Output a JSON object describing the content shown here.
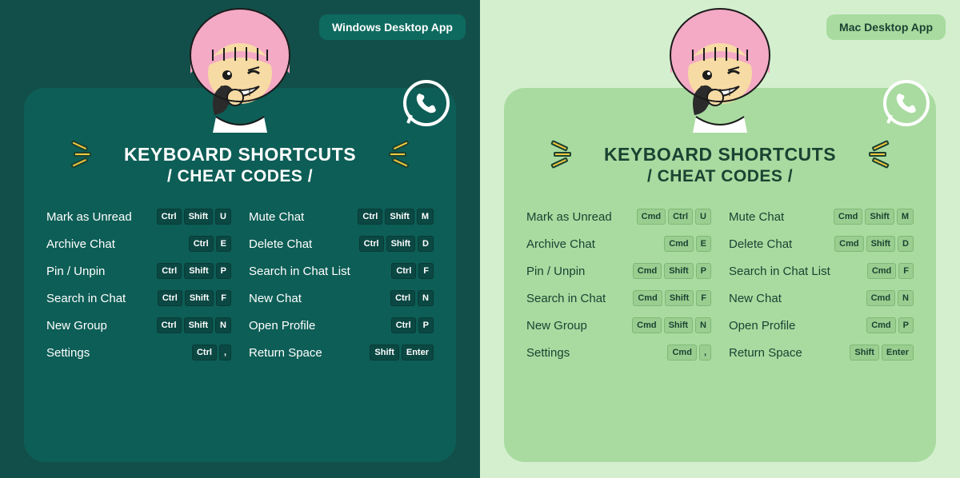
{
  "title_line1": "KEYBOARD SHORTCUTS",
  "title_line2": "/ CHEAT CODES /",
  "panels": [
    {
      "badge": "Windows Desktop App",
      "theme": "dark",
      "colA": [
        {
          "label": "Mark as Unread",
          "keys": [
            "Ctrl",
            "Shift",
            "U"
          ]
        },
        {
          "label": "Archive Chat",
          "keys": [
            "Ctrl",
            "E"
          ]
        },
        {
          "label": "Pin / Unpin",
          "keys": [
            "Ctrl",
            "Shift",
            "P"
          ]
        },
        {
          "label": "Search in Chat",
          "keys": [
            "Ctrl",
            "Shift",
            "F"
          ]
        },
        {
          "label": "New Group",
          "keys": [
            "Ctrl",
            "Shift",
            "N"
          ]
        },
        {
          "label": "Settings",
          "keys": [
            "Ctrl",
            ","
          ]
        }
      ],
      "colB": [
        {
          "label": "Mute Chat",
          "keys": [
            "Ctrl",
            "Shift",
            "M"
          ]
        },
        {
          "label": "Delete Chat",
          "keys": [
            "Ctrl",
            "Shift",
            "D"
          ]
        },
        {
          "label": "Search in Chat List",
          "keys": [
            "Ctrl",
            "F"
          ]
        },
        {
          "label": "New Chat",
          "keys": [
            "Ctrl",
            "N"
          ]
        },
        {
          "label": "Open Profile",
          "keys": [
            "Ctrl",
            "P"
          ]
        },
        {
          "label": "Return Space",
          "keys": [
            "Shift",
            "Enter"
          ]
        }
      ]
    },
    {
      "badge": "Mac Desktop App",
      "theme": "light",
      "colA": [
        {
          "label": "Mark as Unread",
          "keys": [
            "Cmd",
            "Ctrl",
            "U"
          ]
        },
        {
          "label": "Archive Chat",
          "keys": [
            "Cmd",
            "E"
          ]
        },
        {
          "label": "Pin / Unpin",
          "keys": [
            "Cmd",
            "Shift",
            "P"
          ]
        },
        {
          "label": "Search in Chat",
          "keys": [
            "Cmd",
            "Shift",
            "F"
          ]
        },
        {
          "label": "New Group",
          "keys": [
            "Cmd",
            "Shift",
            "N"
          ]
        },
        {
          "label": "Settings",
          "keys": [
            "Cmd",
            ","
          ]
        }
      ],
      "colB": [
        {
          "label": "Mute Chat",
          "keys": [
            "Cmd",
            "Shift",
            "M"
          ]
        },
        {
          "label": "Delete Chat",
          "keys": [
            "Cmd",
            "Shift",
            "D"
          ]
        },
        {
          "label": "Search in Chat List",
          "keys": [
            "Cmd",
            "F"
          ]
        },
        {
          "label": "New Chat",
          "keys": [
            "Cmd",
            "N"
          ]
        },
        {
          "label": "Open Profile",
          "keys": [
            "Cmd",
            "P"
          ]
        },
        {
          "label": "Return Space",
          "keys": [
            "Shift",
            "Enter"
          ]
        }
      ]
    }
  ]
}
